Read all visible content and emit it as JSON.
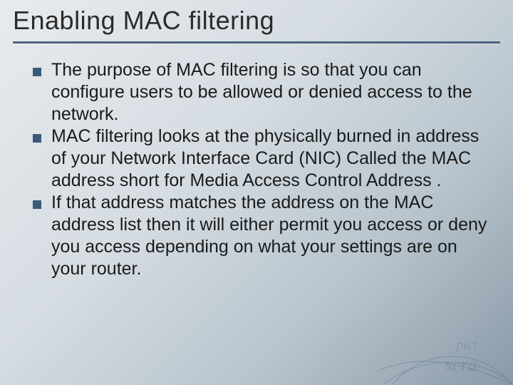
{
  "title": "Enabling MAC filtering",
  "bullets": [
    "The purpose of MAC filtering is so that you can configure users to be allowed or denied access to the network.",
    "MAC filtering looks at the physically burned in address of your Network Interface Card (NIC) Called the MAC address short for Media Access Control Address .",
    "If that address matches the address on the MAC address list then it will either permit you access or deny you access depending on what your settings are on your router."
  ]
}
